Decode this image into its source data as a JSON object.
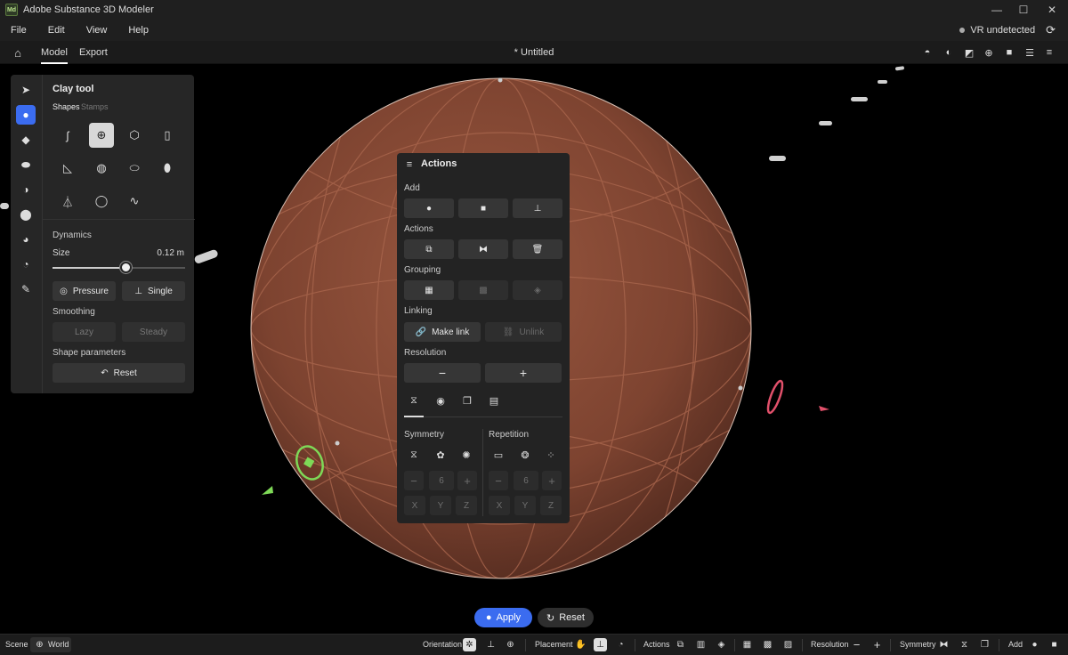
{
  "window": {
    "app_icon": "Md",
    "title": "Adobe Substance 3D Modeler",
    "controls": [
      "minimize-icon",
      "maximize-icon",
      "close-icon"
    ]
  },
  "menubar": {
    "items": [
      "File",
      "Edit",
      "View",
      "Help"
    ],
    "vr_status": "VR undetected"
  },
  "tabs": {
    "items": [
      "Model",
      "Export"
    ],
    "active": "Model",
    "document_title": "*  Untitled"
  },
  "clay_panel": {
    "title": "Clay tool",
    "subtabs": [
      "Shapes",
      "Stamps"
    ],
    "active_subtab": "Shapes",
    "dynamics_label": "Dynamics",
    "size_label": "Size",
    "size_value": "0.12 m",
    "size_slider_fraction": 0.55,
    "pressure_label": "Pressure",
    "single_label": "Single",
    "smoothing_label": "Smoothing",
    "lazy_label": "Lazy",
    "steady_label": "Steady",
    "shape_params_label": "Shape parameters",
    "reset_label": "Reset"
  },
  "actions_panel": {
    "title": "Actions",
    "add_label": "Add",
    "actions_label": "Actions",
    "grouping_label": "Grouping",
    "linking_label": "Linking",
    "make_link_label": "Make link",
    "unlink_label": "Unlink",
    "resolution_label": "Resolution",
    "minus": "−",
    "plus": "+",
    "symmetry_label": "Symmetry",
    "repetition_label": "Repetition",
    "sym_count": "6",
    "rep_count": "6",
    "axes": [
      "X",
      "Y",
      "Z"
    ]
  },
  "bottom": {
    "apply_label": "Apply",
    "reset_label": "Reset"
  },
  "statusbar": {
    "scene_label": "Scene",
    "world_label": "World",
    "orientation_label": "Orientation",
    "placement_label": "Placement",
    "actions_label": "Actions",
    "resolution_label": "Resolution",
    "symmetry_label": "Symmetry",
    "add_label": "Add"
  },
  "colors": {
    "accent": "#3b6cf0",
    "sphere": "#8a4a33",
    "gizmo_green": "#7ed957",
    "gizmo_red": "#e0506a"
  }
}
